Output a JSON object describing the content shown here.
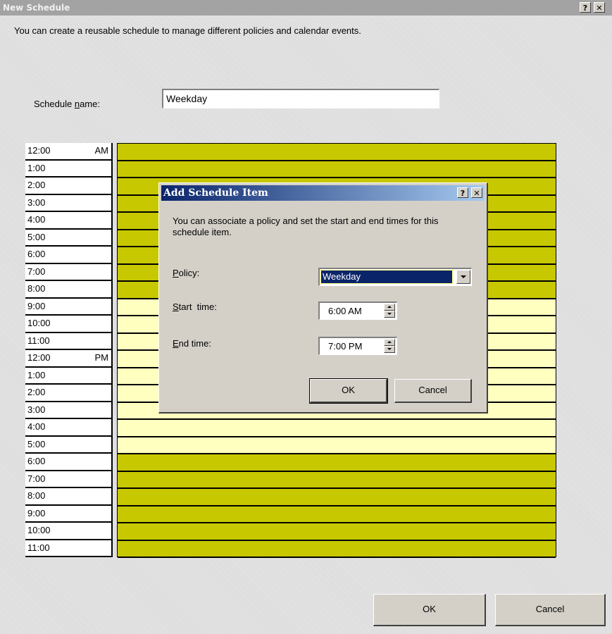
{
  "window": {
    "title": "New Schedule",
    "help_label": "?",
    "close_label": "✕"
  },
  "description": "You can create a reusable schedule to manage different policies and calendar events.",
  "schedule_name": {
    "label_pre": "Schedule ",
    "label_accel": "n",
    "label_post": "ame:",
    "value": "Weekday"
  },
  "colors": {
    "olive": "#c8c800",
    "light_yellow": "#ffffc0",
    "dialog_title": "#0a246a"
  },
  "hours": [
    {
      "time": "12:00",
      "ampm": "AM",
      "band": "olive"
    },
    {
      "time": "1:00",
      "ampm": "",
      "band": "olive"
    },
    {
      "time": "2:00",
      "ampm": "",
      "band": "olive"
    },
    {
      "time": "3:00",
      "ampm": "",
      "band": "olive"
    },
    {
      "time": "4:00",
      "ampm": "",
      "band": "olive"
    },
    {
      "time": "5:00",
      "ampm": "",
      "band": "olive"
    },
    {
      "time": "6:00",
      "ampm": "",
      "band": "olive"
    },
    {
      "time": "7:00",
      "ampm": "",
      "band": "olive"
    },
    {
      "time": "8:00",
      "ampm": "",
      "band": "olive"
    },
    {
      "time": "9:00",
      "ampm": "",
      "band": "light_yellow"
    },
    {
      "time": "10:00",
      "ampm": "",
      "band": "light_yellow"
    },
    {
      "time": "11:00",
      "ampm": "",
      "band": "light_yellow"
    },
    {
      "time": "12:00",
      "ampm": "PM",
      "band": "light_yellow"
    },
    {
      "time": "1:00",
      "ampm": "",
      "band": "light_yellow"
    },
    {
      "time": "2:00",
      "ampm": "",
      "band": "light_yellow"
    },
    {
      "time": "3:00",
      "ampm": "",
      "band": "light_yellow"
    },
    {
      "time": "4:00",
      "ampm": "",
      "band": "light_yellow"
    },
    {
      "time": "5:00",
      "ampm": "",
      "band": "light_yellow"
    },
    {
      "time": "6:00",
      "ampm": "",
      "band": "olive"
    },
    {
      "time": "7:00",
      "ampm": "",
      "band": "olive"
    },
    {
      "time": "8:00",
      "ampm": "",
      "band": "olive"
    },
    {
      "time": "9:00",
      "ampm": "",
      "band": "olive"
    },
    {
      "time": "10:00",
      "ampm": "",
      "band": "olive"
    },
    {
      "time": "11:00",
      "ampm": "",
      "band": "olive"
    }
  ],
  "dialog": {
    "title": "Add Schedule Item",
    "help_label": "?",
    "close_label": "✕",
    "description": "You can associate a policy and set the start and end times for this schedule item.",
    "policy": {
      "accel": "P",
      "rest": "olicy:",
      "value": "Weekday"
    },
    "start": {
      "accel": "S",
      "rest": "tart  time:",
      "value": "6:00 AM"
    },
    "end": {
      "accel": "E",
      "rest": "nd time:",
      "value": "7:00 PM"
    },
    "ok_label": "OK",
    "cancel_label": "Cancel"
  },
  "footer": {
    "ok_label": "OK",
    "cancel_label": "Cancel"
  }
}
